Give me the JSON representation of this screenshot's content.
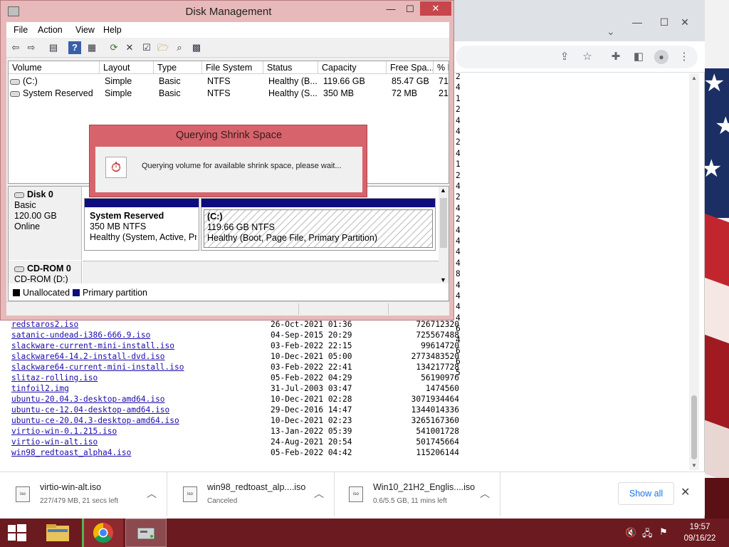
{
  "chrome": {
    "window_controls": [
      "—",
      "☐",
      "✕"
    ],
    "scroll_percents": [
      "2",
      "4",
      "1",
      "2",
      "4",
      "4",
      "2",
      "4",
      "1",
      "2",
      "4",
      "2",
      "4",
      "2",
      "4",
      "4",
      "4",
      "4",
      "8",
      "4",
      "4",
      "4",
      "4",
      "6",
      "4",
      "6",
      "6",
      "5"
    ],
    "files": [
      {
        "name": "redstaros2.iso",
        "date": "26-Oct-2021 01:36",
        "size": "726712320"
      },
      {
        "name": "satanic-undead-i386-666.9.iso",
        "date": "04-Sep-2015 20:29",
        "size": "725567488"
      },
      {
        "name": "slackware-current-mini-install.iso",
        "date": "03-Feb-2022 22:15",
        "size": "99614720"
      },
      {
        "name": "slackware64-14.2-install-dvd.iso",
        "date": "10-Dec-2021 05:00",
        "size": "2773483520"
      },
      {
        "name": "slackware64-current-mini-install.iso",
        "date": "03-Feb-2022 22:41",
        "size": "134217728"
      },
      {
        "name": "slitaz-rolling.iso",
        "date": "05-Feb-2022 04:29",
        "size": "56190976"
      },
      {
        "name": "tinfoil2.img",
        "date": "31-Jul-2003 03:47",
        "size": "1474560"
      },
      {
        "name": "ubuntu-20.04.3-desktop-amd64.iso",
        "date": "10-Dec-2021 02:28",
        "size": "3071934464"
      },
      {
        "name": "ubuntu-ce-12.04-desktop-amd64.iso",
        "date": "29-Dec-2016 14:47",
        "size": "1344014336"
      },
      {
        "name": "ubuntu-ce-20.04.3-desktop-amd64.iso",
        "date": "10-Dec-2021 02:23",
        "size": "3265167360"
      },
      {
        "name": "virtio-win-0.1.215.iso",
        "date": "13-Jan-2022 05:39",
        "size": "541001728"
      },
      {
        "name": "virtio-win-alt.iso",
        "date": "24-Aug-2021 20:54",
        "size": "501745664"
      },
      {
        "name": "win98_redtoast_alpha4.iso",
        "date": "05-Feb-2022 04:42",
        "size": "115206144"
      }
    ],
    "downloads": [
      {
        "name": "virtio-win-alt.iso",
        "status": "227/479 MB, 21 secs left",
        "icon": "iso"
      },
      {
        "name": "win98_redtoast_alp....iso",
        "status": "Canceled",
        "icon": "iso"
      },
      {
        "name": "Win10_21H2_Englis....iso",
        "status": "0.6/5.5 GB, 11 mins left",
        "icon": "iso"
      }
    ],
    "show_all": "Show all"
  },
  "disk_mgmt": {
    "title": "Disk Management",
    "menu": [
      "File",
      "Action",
      "View",
      "Help"
    ],
    "columns": [
      "Volume",
      "Layout",
      "Type",
      "File System",
      "Status",
      "Capacity",
      "Free Spa...",
      "% F"
    ],
    "rows": [
      [
        "(C:)",
        "Simple",
        "Basic",
        "NTFS",
        "Healthy (B...",
        "119.66 GB",
        "85.47 GB",
        "71"
      ],
      [
        "System Reserved",
        "Simple",
        "Basic",
        "NTFS",
        "Healthy (S...",
        "350 MB",
        "72 MB",
        "21"
      ]
    ],
    "disk0": {
      "name": "Disk 0",
      "type": "Basic",
      "size": "120.00 GB",
      "state": "Online"
    },
    "partitions": [
      {
        "name": "System Reserved",
        "size": "350 MB NTFS",
        "status": "Healthy (System, Active, Prir"
      },
      {
        "name": "(C:)",
        "size": "119.66 GB NTFS",
        "status": "Healthy (Boot, Page File, Primary Partition)"
      }
    ],
    "cdrom": {
      "name": "CD-ROM 0",
      "sub": "CD-ROM (D:)"
    },
    "legend": [
      "Unallocated",
      "Primary partition"
    ],
    "legend_colors": [
      "#000000",
      "#0e0c7f"
    ]
  },
  "dialog": {
    "title": "Querying Shrink Space",
    "message": "Querying volume for available shrink space, please wait..."
  },
  "taskbar": {
    "time": "19:57",
    "date": "09/16/22"
  }
}
